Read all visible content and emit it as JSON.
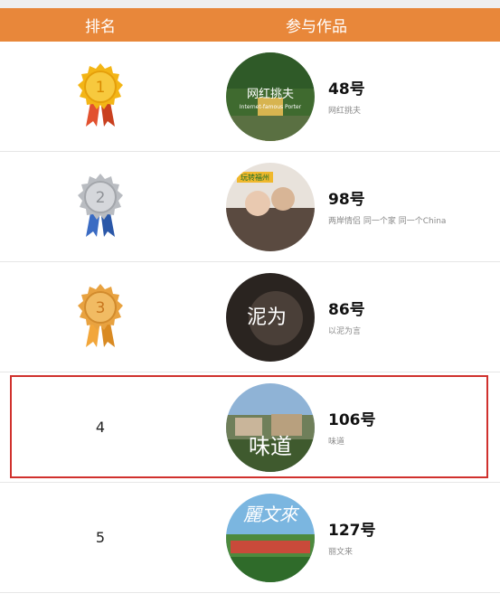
{
  "header": {
    "rank_label": "排名",
    "work_label": "参与作品"
  },
  "rows": [
    {
      "rank_icon": "gold-medal-icon",
      "rank_text": "1",
      "number": "48号",
      "desc": "网红挑夫",
      "thumb_text": "网红挑夫",
      "thumb_sub": "Internet-famous Porter"
    },
    {
      "rank_icon": "silver-medal-icon",
      "rank_text": "2",
      "number": "98号",
      "desc": "两岸情侣 同一个家 同一个China",
      "thumb_text": "玩转福州"
    },
    {
      "rank_icon": "bronze-medal-icon",
      "rank_text": "3",
      "number": "86号",
      "desc": "以泥为言",
      "thumb_text": "泥为"
    },
    {
      "rank_text": "4",
      "number": "106号",
      "desc": "味道",
      "thumb_text": "味道"
    },
    {
      "rank_text": "5",
      "number": "127号",
      "desc": "丽文来",
      "thumb_text": "麗文來"
    }
  ],
  "colors": {
    "header_bg": "#e8873a",
    "highlight_border": "#d0312d",
    "gold": "#f3b516",
    "silver": "#b9bcc1",
    "bronze": "#e8a240"
  }
}
